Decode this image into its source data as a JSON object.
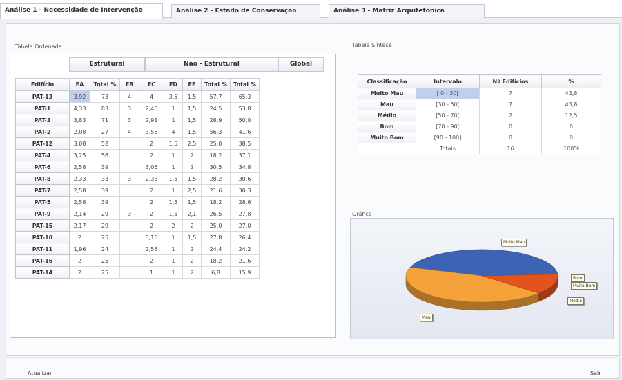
{
  "tabs": [
    {
      "label": "Análise 1 - Necessidade de Intervenção"
    },
    {
      "label": "Análise 2 - Estado de Conservação"
    },
    {
      "label": "Análise 3 - Matriz Arquitetónica"
    }
  ],
  "left": {
    "section_title": "Tabela Ordenada",
    "groups": {
      "estrutural": "Estrutural",
      "nao_estrutural": "Não - Estrutural",
      "global": "Global"
    },
    "columns": [
      "Edifício",
      "EA",
      "Total %",
      "EB",
      "EC",
      "ED",
      "EE",
      "Total %",
      "Total %"
    ],
    "rows": [
      [
        "PAT-13",
        "3,92",
        "73",
        "4",
        "4",
        "3,5",
        "1,5",
        "57,7",
        "65,3"
      ],
      [
        "PAT-1",
        "4,33",
        "83",
        "3",
        "2,45",
        "1",
        "1,5",
        "24,5",
        "53,8"
      ],
      [
        "PAT-3",
        "3,83",
        "71",
        "3",
        "2,91",
        "1",
        "1,5",
        "28,9",
        "50,0"
      ],
      [
        "PAT-2",
        "2,08",
        "27",
        "4",
        "3,55",
        "4",
        "1,5",
        "56,3",
        "41,6"
      ],
      [
        "PAT-12",
        "3,08",
        "52",
        "",
        "2",
        "1,5",
        "2,5",
        "25,0",
        "38,5"
      ],
      [
        "PAT-4",
        "3,25",
        "56",
        "",
        "2",
        "1",
        "2",
        "18,2",
        "37,1"
      ],
      [
        "PAT-6",
        "2,58",
        "39",
        "",
        "3,06",
        "1",
        "2",
        "30,5",
        "34,8"
      ],
      [
        "PAT-8",
        "2,33",
        "33",
        "3",
        "2,33",
        "1,5",
        "1,5",
        "28,2",
        "30,6"
      ],
      [
        "PAT-7",
        "2,58",
        "39",
        "",
        "2",
        "1",
        "2,5",
        "21,6",
        "30,3"
      ],
      [
        "PAT-5",
        "2,58",
        "39",
        "",
        "2",
        "1,5",
        "1,5",
        "18,2",
        "28,6"
      ],
      [
        "PAT-9",
        "2,14",
        "29",
        "3",
        "2",
        "1,5",
        "2,1",
        "26,5",
        "27,8"
      ],
      [
        "PAT-15",
        "2,17",
        "29",
        "",
        "2",
        "2",
        "2",
        "25,0",
        "27,0"
      ],
      [
        "PAT-10",
        "2",
        "25",
        "",
        "3,15",
        "1",
        "1,5",
        "27,8",
        "26,4"
      ],
      [
        "PAT-11",
        "1,96",
        "24",
        "",
        "2,55",
        "1",
        "2",
        "24,4",
        "24,2"
      ],
      [
        "PAT-16",
        "2",
        "25",
        "",
        "2",
        "1",
        "2",
        "18,2",
        "21,6"
      ],
      [
        "PAT-14",
        "2",
        "25",
        "",
        "1",
        "1",
        "2",
        "6,8",
        "15,9"
      ]
    ]
  },
  "synth": {
    "section_title": "Tabela Síntese",
    "columns": [
      "Classificação",
      "Intervalo",
      "Nº Edifícios",
      "%"
    ],
    "rows": [
      [
        "Muito Mau",
        "[ 0 - 30[",
        "7",
        "43,8"
      ],
      [
        "Mau",
        "[30 - 50[",
        "7",
        "43,8"
      ],
      [
        "Médio",
        "[50 - 70[",
        "2",
        "12,5"
      ],
      [
        "Bom",
        "[70 - 90[",
        "0",
        "0"
      ],
      [
        "Muito Bom",
        "[90 - 100]",
        "0",
        "0"
      ]
    ],
    "totals": {
      "label": "Totais",
      "count": "16",
      "percent": "100%"
    }
  },
  "chart": {
    "section_title": "Gráfico",
    "labels": {
      "muito_mau": "Muito Mau",
      "bom": "Bom",
      "muito_bom": "Muito Bom",
      "medio": "Médio",
      "mau": "Mau"
    },
    "colors": {
      "muito_mau": "#3c63b4",
      "mau": "#f5a23a",
      "medio": "#e4521e",
      "bom": "#a8bfe6",
      "muito_bom": "#8fc26a"
    }
  },
  "chart_data": {
    "type": "pie",
    "categories": [
      "Muito Mau",
      "Mau",
      "Médio",
      "Bom",
      "Muito Bom"
    ],
    "values": [
      43.8,
      43.8,
      12.5,
      0,
      0
    ]
  },
  "footer": {
    "refresh_label": "Atualizar",
    "exit_label": "Sair"
  }
}
